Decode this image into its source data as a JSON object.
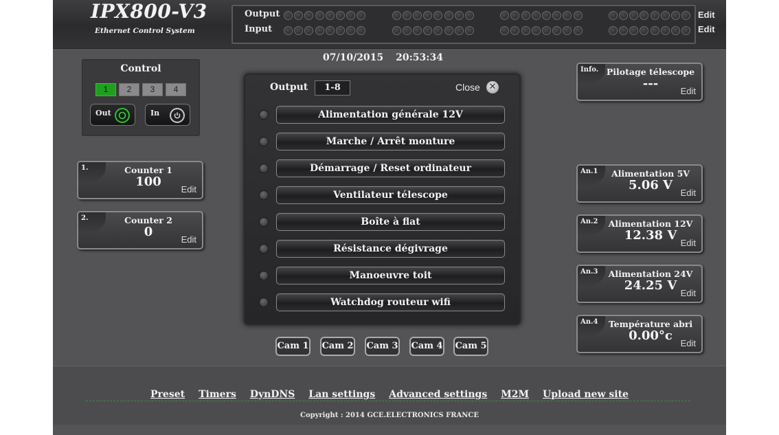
{
  "header": {
    "title": "IPX800-V3",
    "subtitle": "Ethernet Control System"
  },
  "io": {
    "output_label": "Output",
    "input_label": "Input",
    "edit_output": "Edit",
    "edit_input": "Edit",
    "groups": 4,
    "leds_per_group": 8
  },
  "datetime": {
    "date": "07/10/2015",
    "time": "20:53:34"
  },
  "control": {
    "title": "Control",
    "pages": [
      "1",
      "2",
      "3",
      "4"
    ],
    "active_page": "1",
    "out_label": "Out",
    "in_label": "In",
    "out_color": "#2fc02f"
  },
  "counters": [
    {
      "tag": "1.",
      "title": "Counter 1",
      "value": "100",
      "edit": "Edit"
    },
    {
      "tag": "2.",
      "title": "Counter 2",
      "value": "0",
      "edit": "Edit"
    }
  ],
  "info": {
    "tag": "Info.",
    "title": "Pilotage télescope",
    "value": "---",
    "edit": "Edit"
  },
  "analogs": [
    {
      "tag": "An.1",
      "title": "Alimentation 5V",
      "value": "5.06 V",
      "edit": "Edit"
    },
    {
      "tag": "An.2",
      "title": "Alimentation 12V",
      "value": "12.38 V",
      "edit": "Edit"
    },
    {
      "tag": "An.3",
      "title": "Alimentation 24V",
      "value": "24.25 V",
      "edit": "Edit"
    },
    {
      "tag": "An.4",
      "title": "Température abri",
      "value": "0.00°c",
      "edit": "Edit"
    }
  ],
  "output_modal": {
    "label": "Output",
    "range": "1-8",
    "close_label": "Close",
    "outputs": [
      "Alimentation générale 12V",
      "Marche / Arrêt monture",
      "Démarrage / Reset ordinateur",
      "Ventilateur télescope",
      "Boîte à flat",
      "Résistance dégivrage",
      "Manoeuvre toit",
      "Watchdog routeur wifi"
    ]
  },
  "cams": [
    "Cam 1",
    "Cam 2",
    "Cam 3",
    "Cam 4",
    "Cam 5"
  ],
  "footer": {
    "links": [
      "Preset",
      "Timers",
      "DynDNS",
      "Lan settings",
      "Advanced settings",
      "M2M",
      "Upload new site"
    ],
    "copyright": "Copyright : 2014 GCE.ELECTRONICS FRANCE"
  }
}
